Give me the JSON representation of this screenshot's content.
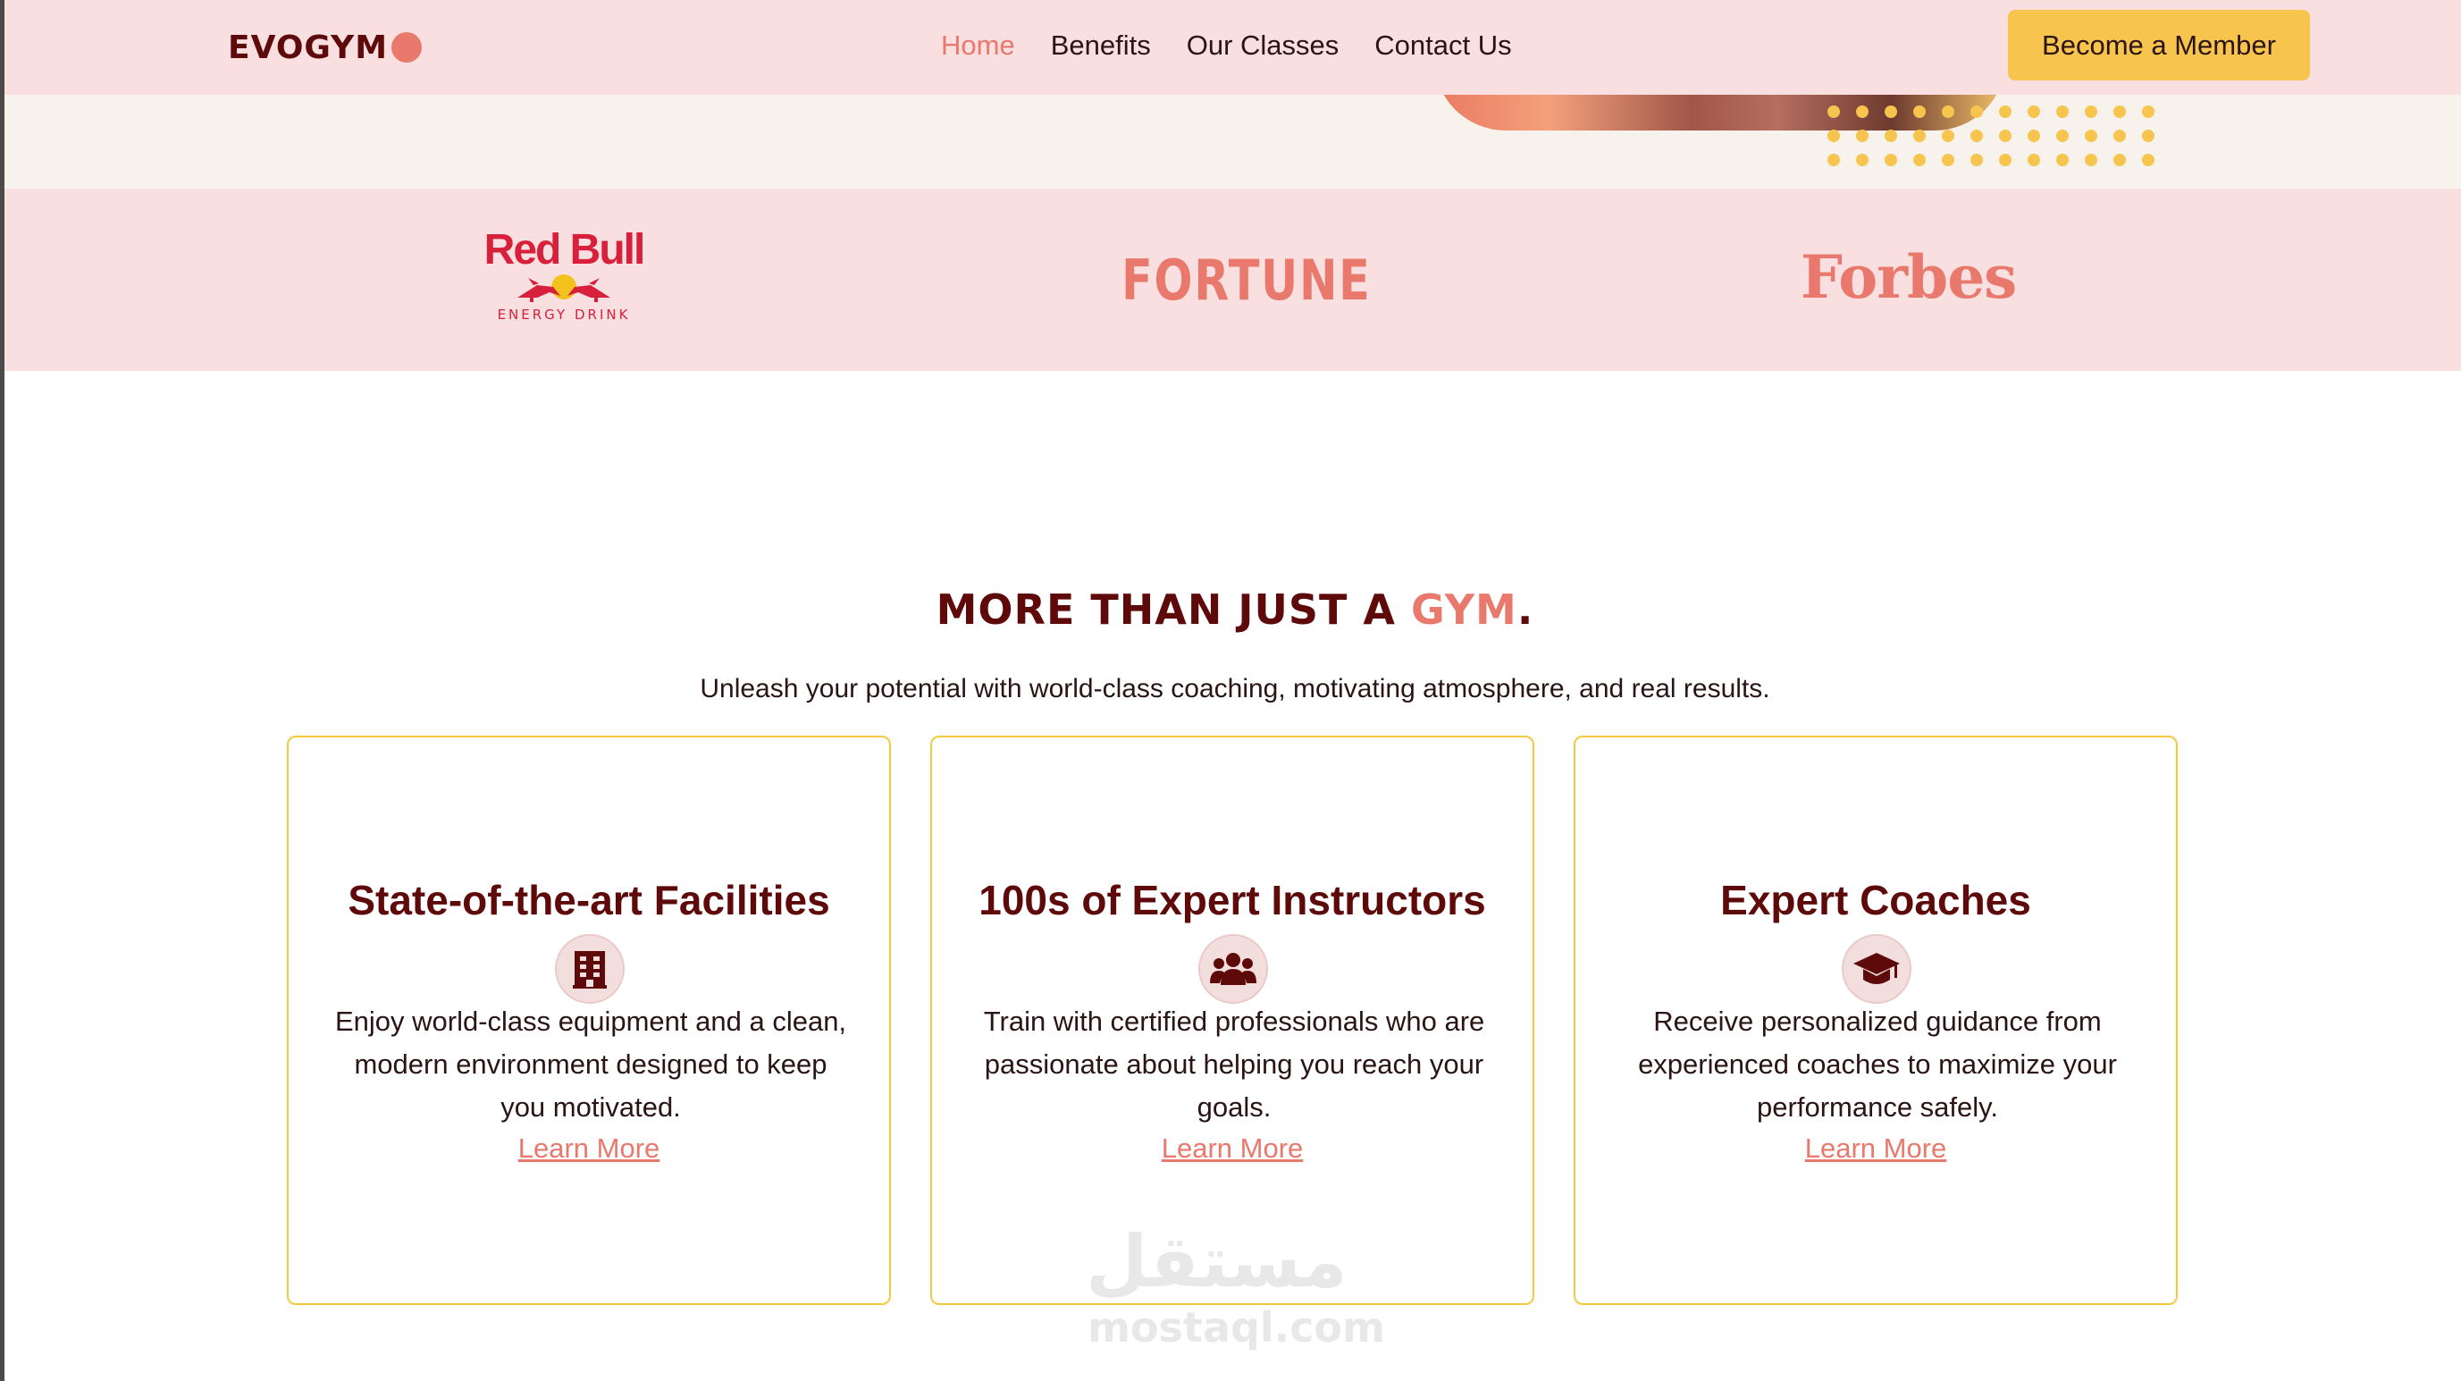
{
  "brand": {
    "name": "EVOGYM",
    "accent_color": "#e8796c",
    "dark_color": "#5e0a0a"
  },
  "nav": {
    "links": [
      {
        "label": "Home",
        "active": true
      },
      {
        "label": "Benefits",
        "active": false
      },
      {
        "label": "Our Classes",
        "active": false
      },
      {
        "label": "Contact Us",
        "active": false
      }
    ],
    "cta_label": "Become a Member",
    "cta_color": "#f7c44e"
  },
  "sponsors": {
    "redbull": {
      "name": "Red Bull",
      "tagline": "ENERGY DRINK"
    },
    "fortune": {
      "name": "FORTUNE"
    },
    "forbes": {
      "name": "Forbes"
    }
  },
  "section": {
    "title_main": "MORE THAN JUST A ",
    "title_accent": "GYM",
    "title_end": ".",
    "subtitle": "Unleash your potential with world-class coaching, motivating atmosphere, and real results."
  },
  "cards": [
    {
      "title": "State-of-the-art Facilities",
      "icon": "building-icon",
      "description": "Enjoy world-class equipment and a clean, modern environment designed to keep you motivated.",
      "link": "Learn More"
    },
    {
      "title": "100s of Expert Instructors",
      "icon": "users-icon",
      "description": "Train with certified professionals who are passionate about helping you reach your goals.",
      "link": "Learn More"
    },
    {
      "title": "Expert Coaches",
      "icon": "graduation-cap-icon",
      "description": "Receive personalized guidance from experienced coaches to maximize your performance safely.",
      "link": "Learn More"
    }
  ],
  "watermark": {
    "arabic": "مستقل",
    "latin": "mostaql.com"
  }
}
